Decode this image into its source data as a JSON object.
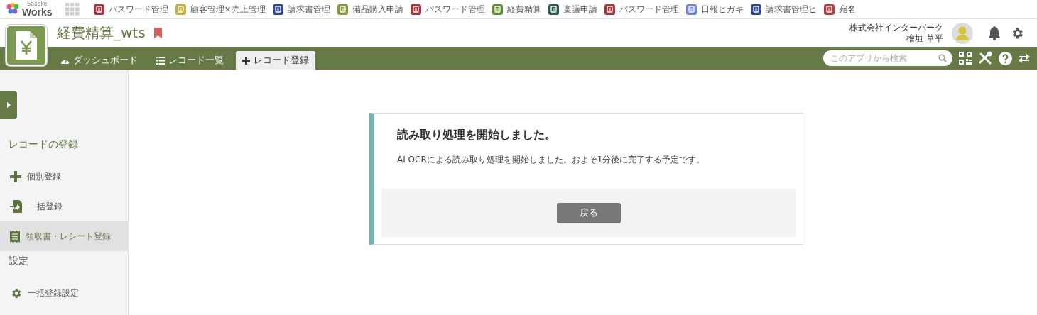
{
  "logo": {
    "tagline": "Saaske",
    "name": "Works"
  },
  "app_links": [
    {
      "label": "パスワード管理",
      "color": "#a8323a"
    },
    {
      "label": "顧客管理×売上管理",
      "color": "#c2b23a"
    },
    {
      "label": "請求書管理",
      "color": "#34468f"
    },
    {
      "label": "備品購入申請",
      "color": "#7f9a3c"
    },
    {
      "label": "パスワード管理",
      "color": "#a8323a"
    },
    {
      "label": "経費精算",
      "color": "#5f8a34"
    },
    {
      "label": "稟議申請",
      "color": "#2f5a4f"
    },
    {
      "label": "パスワード管理",
      "color": "#a8323a"
    },
    {
      "label": "日報ヒガキ",
      "color": "#6d82d8"
    },
    {
      "label": "請求書管理ヒ",
      "color": "#34468f"
    },
    {
      "label": "宛名",
      "color": "#b8413d"
    }
  ],
  "app": {
    "title": "経費精算_wts",
    "bookmarked": true
  },
  "user": {
    "company": "株式会社インターパーク",
    "name": "檜垣 草平"
  },
  "tabs": [
    {
      "label": "ダッシュボード",
      "kind": "gauge",
      "selected": false
    },
    {
      "label": "レコード一覧",
      "kind": "list",
      "selected": false
    },
    {
      "label": "レコード登録",
      "kind": "plus",
      "selected": true
    }
  ],
  "search": {
    "placeholder": "このアプリから検索"
  },
  "sidebar": {
    "sections": [
      {
        "title": "レコードの登録",
        "items": [
          {
            "label": "個別登録",
            "kind": "plus",
            "selected": false
          },
          {
            "label": "一括登録",
            "kind": "import",
            "selected": false
          },
          {
            "label": "領収書・レシート登録",
            "kind": "receipt",
            "selected": true
          }
        ]
      },
      {
        "title": "設定",
        "items": [
          {
            "label": "一括登録設定",
            "kind": "gear",
            "selected": false
          }
        ]
      }
    ]
  },
  "notice": {
    "title": "読み取り処理を開始しました。",
    "message": "AI OCRによる読み取り処理を開始しました。およそ1分後に完了する予定です。",
    "button": "戻る"
  }
}
